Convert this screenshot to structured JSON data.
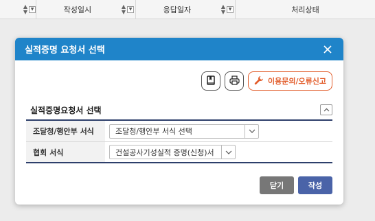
{
  "background_table": {
    "columns": [
      {
        "label": ""
      },
      {
        "label": "작성일시"
      },
      {
        "label": "응답일자"
      },
      {
        "label": "처리상태"
      }
    ],
    "sort_icon": "sort-updown-icon",
    "filter_icon": "filter-dropdown-icon"
  },
  "modal": {
    "title": "실적증명 요청서 선택",
    "close_icon": "close-icon",
    "toolbar": {
      "manual_icon": "book-icon",
      "print_icon": "print-icon",
      "help_label": "이용문의/오류신고",
      "help_icon": "wrench-icon"
    },
    "section": {
      "title": "실적증명요청서 선택",
      "collapse_icon": "chevron-up-icon",
      "rows": [
        {
          "label": "조달청/행안부 서식",
          "selected": "조달청/행안부 서식 선택"
        },
        {
          "label": "협회 서식",
          "selected": "건설공사기성실적 증명(신청)서"
        }
      ]
    },
    "footer": {
      "close_label": "닫기",
      "write_label": "작성"
    },
    "colors": {
      "header": "#1f84c9",
      "help": "#e25c2a",
      "write": "#4a63a8",
      "close": "#777777"
    }
  }
}
